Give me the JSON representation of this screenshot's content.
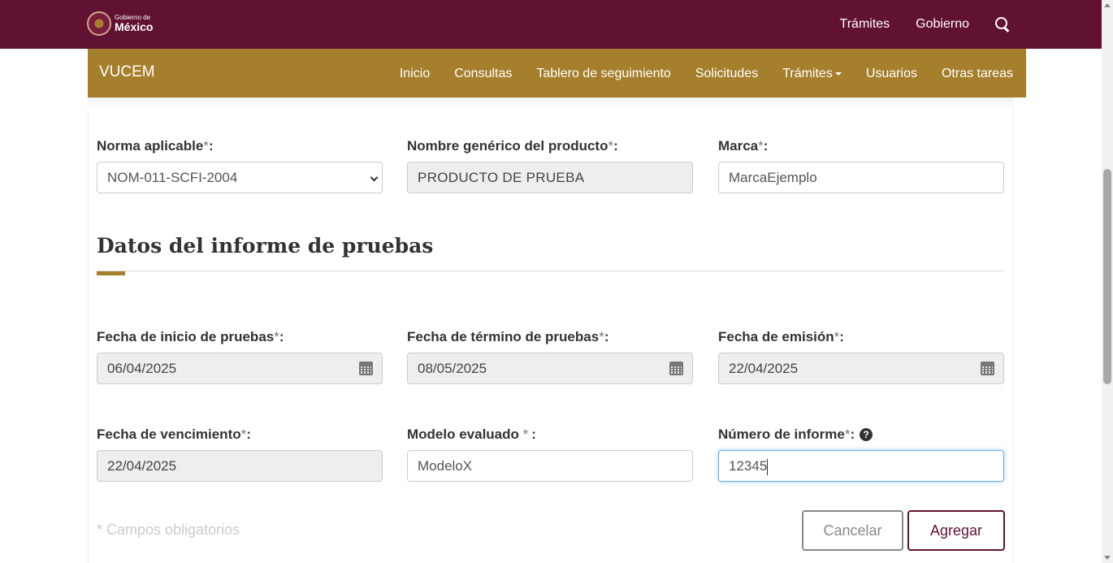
{
  "header": {
    "logo_small": "Gobierno de",
    "logo_big": "México",
    "nav": [
      "Trámites",
      "Gobierno"
    ]
  },
  "subnav": {
    "brand": "VUCEM",
    "items": [
      "Inicio",
      "Consultas",
      "Tablero de seguimiento",
      "Solicitudes",
      "Trámites",
      "Usuarios",
      "Otras tareas"
    ]
  },
  "form": {
    "norma": {
      "label": "Norma aplicable",
      "value": "NOM-011-SCFI-2004"
    },
    "nombre": {
      "label": "Nombre genérico del producto",
      "value": "PRODUCTO DE PRUEBA"
    },
    "marca": {
      "label": "Marca",
      "value": "MarcaEjemplo"
    },
    "section_title": "Datos del informe de pruebas",
    "fecha_inicio": {
      "label": "Fecha de inicio de pruebas",
      "value": "06/04/2025"
    },
    "fecha_termino": {
      "label": "Fecha de término de pruebas",
      "value": "08/05/2025"
    },
    "fecha_emision": {
      "label": "Fecha de emisión",
      "value": "22/04/2025"
    },
    "fecha_vencimiento": {
      "label": "Fecha de vencimiento",
      "value": "22/04/2025"
    },
    "modelo": {
      "label": "Modelo evaluado ",
      "value": "ModeloX"
    },
    "numero": {
      "label": "Número de informe",
      "value": "12345"
    },
    "required_mark": "*",
    "colon": ":",
    "help_glyph": "?",
    "required_note": "* Campos obligatorios",
    "cancel_label": "Cancelar",
    "add_label": "Agregar"
  },
  "colors": {
    "header": "#611232",
    "subnav": "#a57f2c",
    "accent": "#a57f2c"
  }
}
